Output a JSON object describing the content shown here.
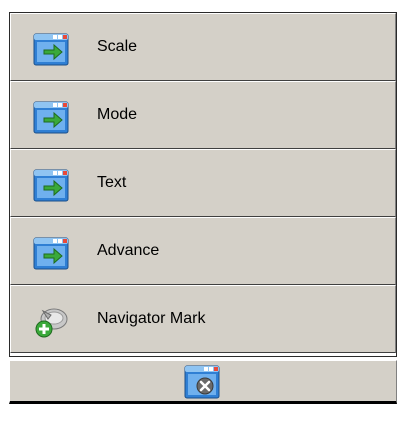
{
  "menu": {
    "items": [
      {
        "label": "Scale",
        "icon": "window-arrow-icon"
      },
      {
        "label": "Mode",
        "icon": "window-arrow-icon"
      },
      {
        "label": "Text",
        "icon": "window-arrow-icon"
      },
      {
        "label": "Advance",
        "icon": "window-arrow-icon"
      },
      {
        "label": "Navigator Mark",
        "icon": "navigator-mark-add-icon"
      }
    ]
  },
  "bottom_bar": {
    "close_icon": "window-close-icon"
  },
  "colors": {
    "panel_bg": "#d4d0c8",
    "window_blue": "#2f7fd4",
    "arrow_green": "#3aa93a",
    "close_gray": "#6a6a6a"
  }
}
